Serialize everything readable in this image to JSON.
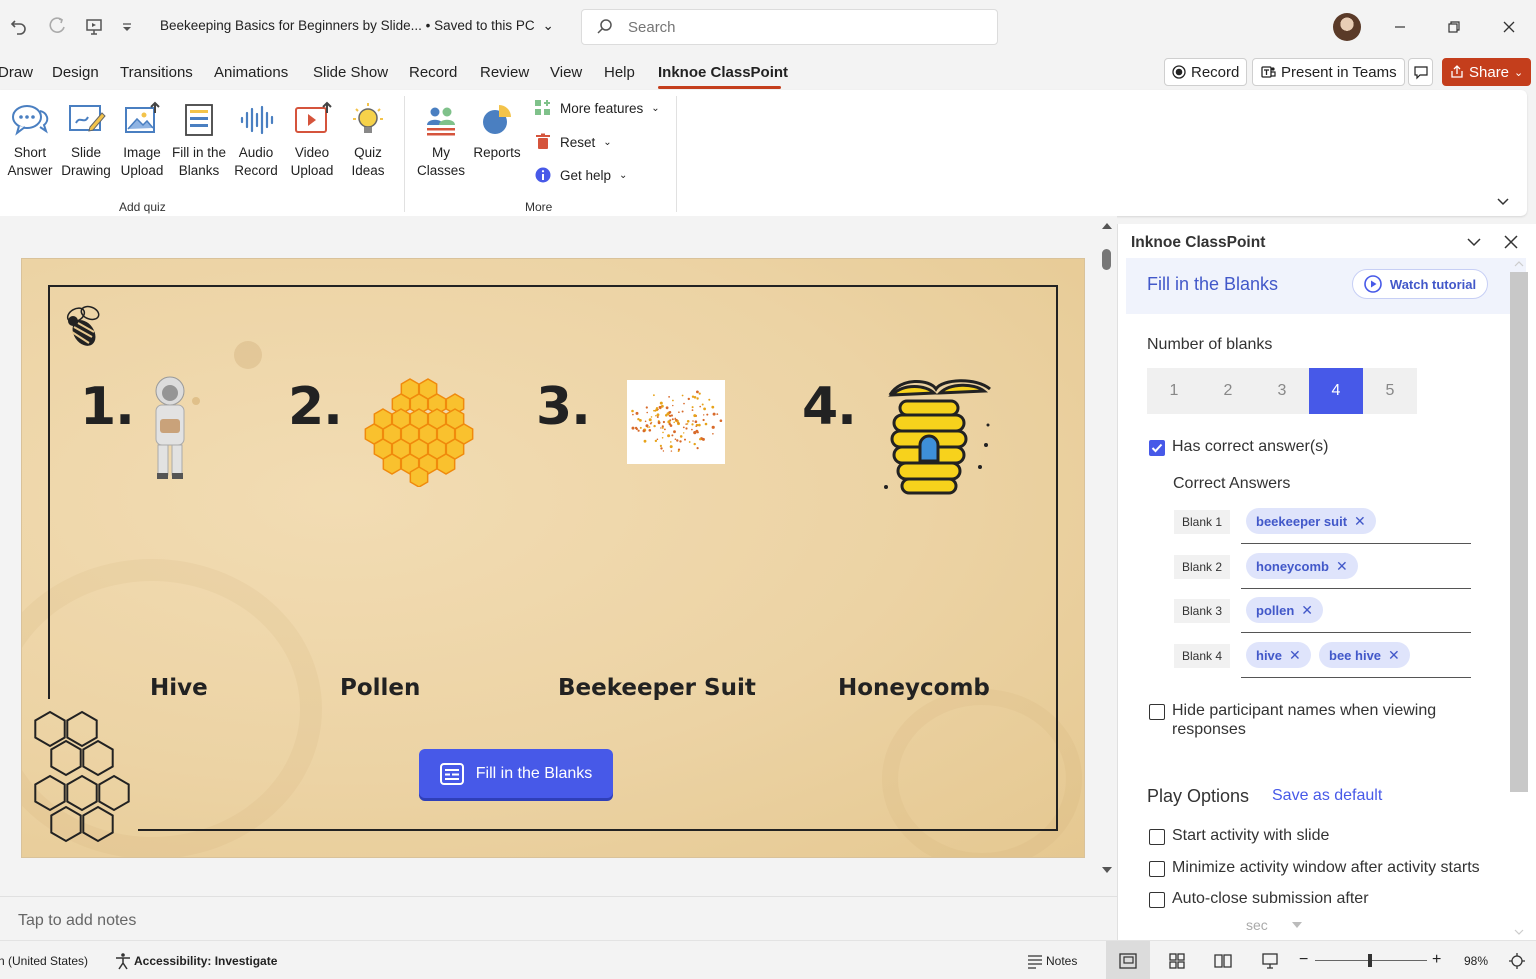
{
  "titlebar": {
    "doc_title": "Beekeeping Basics for Beginners by Slide... • Saved to this PC",
    "search_placeholder": "Search"
  },
  "menu": {
    "tabs": [
      "Draw",
      "Design",
      "Transitions",
      "Animations",
      "Slide Show",
      "Record",
      "Review",
      "View",
      "Help",
      "Inknoe ClassPoint"
    ],
    "active_tab": "Inknoe ClassPoint",
    "record_label": "Record",
    "present_teams_label": "Present in Teams",
    "share_label": "Share"
  },
  "ribbon": {
    "add_quiz": [
      {
        "line1": "Short",
        "line2": "Answer",
        "icon": "speech-bubbles-icon"
      },
      {
        "line1": "Slide",
        "line2": "Drawing",
        "icon": "drawing-pen-icon"
      },
      {
        "line1": "Image",
        "line2": "Upload",
        "icon": "image-upload-icon"
      },
      {
        "line1": "Fill in the",
        "line2": "Blanks",
        "icon": "fill-blanks-icon"
      },
      {
        "line1": "Audio",
        "line2": "Record",
        "icon": "audio-wave-icon"
      },
      {
        "line1": "Video",
        "line2": "Upload",
        "icon": "video-upload-icon"
      },
      {
        "line1": "Quiz",
        "line2": "Ideas",
        "icon": "lightbulb-icon"
      }
    ],
    "add_quiz_label": "Add quiz",
    "more": [
      {
        "line1": "My",
        "line2": "Classes",
        "icon": "classes-icon"
      },
      {
        "line1": "Reports",
        "line2": "",
        "icon": "pie-chart-icon"
      }
    ],
    "more_label": "More",
    "more_menu": [
      "More features",
      "Reset",
      "Get help"
    ]
  },
  "slide": {
    "numbers": [
      "1.",
      "2.",
      "3.",
      "4."
    ],
    "words": [
      "Hive",
      "Pollen",
      "Beekeeper Suit",
      "Honeycomb"
    ],
    "button_label": "Fill in the Blanks"
  },
  "notes": {
    "placeholder": "Tap to add notes"
  },
  "panel": {
    "title": "Inknoe ClassPoint",
    "section_title": "Fill in the Blanks",
    "watch_tutorial": "Watch tutorial",
    "number_of_blanks_label": "Number of blanks",
    "blank_options": [
      "1",
      "2",
      "3",
      "4",
      "5"
    ],
    "selected_blanks": "4",
    "has_correct_label": "Has correct answer(s)",
    "has_correct_checked": true,
    "correct_answers_label": "Correct Answers",
    "blanks": [
      {
        "label": "Blank 1",
        "answers": [
          "beekeeper suit"
        ]
      },
      {
        "label": "Blank 2",
        "answers": [
          "honeycomb"
        ]
      },
      {
        "label": "Blank 3",
        "answers": [
          "pollen"
        ]
      },
      {
        "label": "Blank 4",
        "answers": [
          "hive",
          "bee hive"
        ]
      }
    ],
    "hide_names_line1": "Hide participant names when viewing",
    "hide_names_line2": "responses",
    "play_options_label": "Play Options",
    "save_default_label": "Save as default",
    "start_with_slide": "Start activity with slide",
    "minimize_window": "Minimize activity window after activity starts",
    "auto_close": "Auto-close submission after",
    "sec_label": "sec"
  },
  "statusbar": {
    "language": "n (United States)",
    "accessibility": "Accessibility: Investigate",
    "notes": "Notes",
    "zoom": "98%"
  },
  "colors": {
    "accent": "#c43e1c",
    "classpoint_blue": "#4759e8",
    "slide_bg": "#ecd3a4"
  }
}
